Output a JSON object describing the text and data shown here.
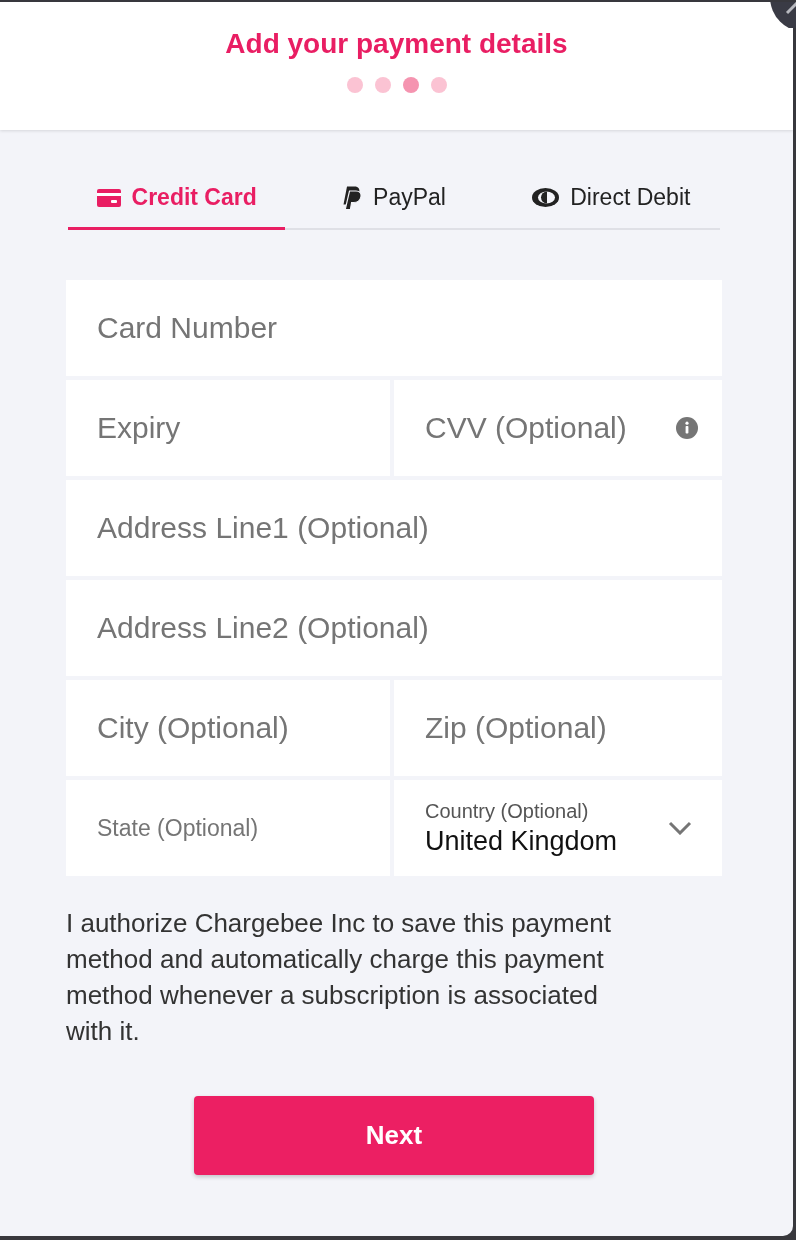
{
  "header": {
    "title": "Add your payment details",
    "steps": [
      {
        "selected": false
      },
      {
        "selected": false
      },
      {
        "selected": true
      },
      {
        "selected": false
      }
    ]
  },
  "tabs": [
    {
      "label": "Credit Card",
      "selected": true
    },
    {
      "label": "PayPal",
      "selected": false
    },
    {
      "label": "Direct Debit",
      "selected": false
    }
  ],
  "form": {
    "rows": [
      {
        "fields": [
          {
            "kind": "input",
            "placeholder": "Card Number"
          }
        ]
      },
      {
        "fields": [
          {
            "kind": "input",
            "placeholder": "Expiry"
          },
          {
            "kind": "input_info",
            "placeholder": "CVV (Optional)"
          }
        ]
      },
      {
        "fields": [
          {
            "kind": "input",
            "placeholder": "Address Line1 (Optional)"
          }
        ]
      },
      {
        "fields": [
          {
            "kind": "input",
            "placeholder": "Address Line2 (Optional)"
          }
        ]
      },
      {
        "fields": [
          {
            "kind": "input",
            "placeholder": "City (Optional)"
          },
          {
            "kind": "input",
            "placeholder": "Zip (Optional)"
          }
        ]
      },
      {
        "fields": [
          {
            "kind": "input_small",
            "placeholder": "State (Optional)"
          },
          {
            "kind": "select",
            "label": "Country (Optional)",
            "value": "United Kingdom"
          }
        ]
      }
    ]
  },
  "authorization": "I authorize Chargebee Inc to save this payment method and automatically charge this payment method whenever a subscription is associated with it.",
  "next_button": {
    "label": "Next"
  }
}
